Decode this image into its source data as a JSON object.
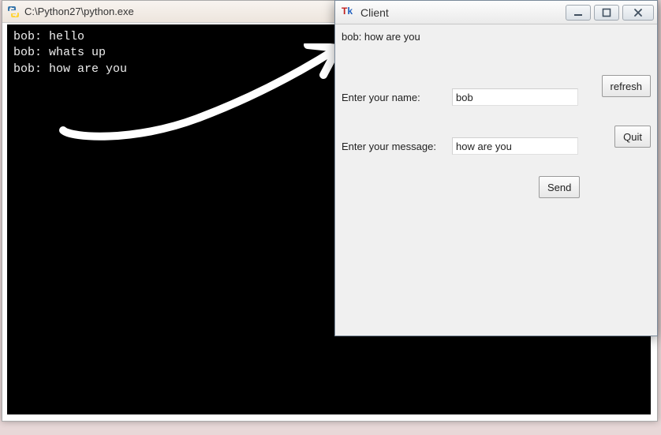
{
  "console": {
    "title": "C:\\Python27\\python.exe",
    "lines": [
      "bob: hello",
      "bob: whats up",
      "bob: how are you"
    ]
  },
  "client": {
    "title": "Client",
    "message_display": "bob: how are you",
    "name_label": "Enter your name:",
    "name_value": "bob",
    "message_label": "Enter your message:",
    "message_value": "how are you",
    "buttons": {
      "refresh": "refresh",
      "quit": "Quit",
      "send": "Send"
    }
  }
}
